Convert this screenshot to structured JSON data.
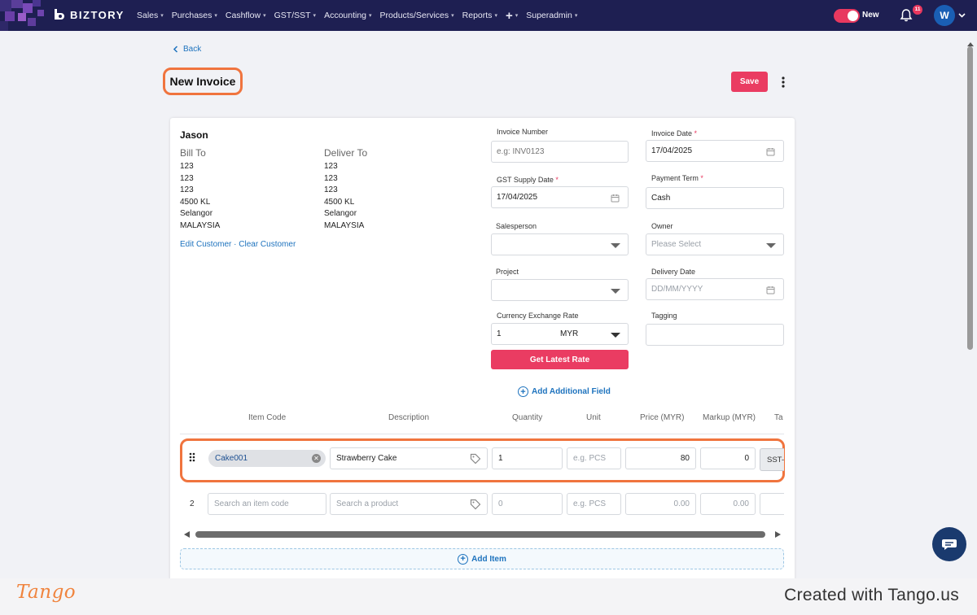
{
  "app": {
    "brand": "BIZTORY",
    "menu": [
      {
        "label": "Sales"
      },
      {
        "label": "Purchases"
      },
      {
        "label": "Cashflow"
      },
      {
        "label": "GST/SST"
      },
      {
        "label": "Accounting"
      },
      {
        "label": "Products/Services"
      },
      {
        "label": "Reports"
      },
      {
        "label": "+"
      },
      {
        "label": "Superadmin"
      }
    ],
    "toggle_label": "New",
    "notification_count": "11",
    "avatar_initial": "W",
    "colors": {
      "nav_bg": "#1e1f52",
      "accent": "#ea3c62",
      "link": "#1e73be",
      "highlight": "#f0743e"
    }
  },
  "page": {
    "back_label": "Back",
    "title": "New Invoice",
    "save_label": "Save"
  },
  "customer": {
    "name": "Jason",
    "bill_to_title": "Bill To",
    "bill_to": [
      "123",
      "123",
      "123",
      "4500 KL",
      "Selangor",
      "MALAYSIA"
    ],
    "deliver_to_title": "Deliver To",
    "deliver_to": [
      "123",
      "123",
      "123",
      "4500 KL",
      "Selangor",
      "MALAYSIA"
    ],
    "edit_link": "Edit Customer",
    "separator": " · ",
    "clear_link": "Clear Customer"
  },
  "fields": {
    "invoice_number": {
      "label": "Invoice Number",
      "placeholder": "e.g: INV0123"
    },
    "invoice_date": {
      "label": "Invoice Date",
      "required": "*",
      "value": "17/04/2025"
    },
    "gst_supply_date": {
      "label": "GST Supply Date",
      "required": "*",
      "value": "17/04/2025"
    },
    "payment_term": {
      "label": "Payment Term",
      "required": "*",
      "value": "Cash"
    },
    "salesperson": {
      "label": "Salesperson",
      "value": ""
    },
    "owner": {
      "label": "Owner",
      "placeholder": "Please Select"
    },
    "project": {
      "label": "Project",
      "value": ""
    },
    "delivery_date": {
      "label": "Delivery Date",
      "placeholder": "DD/MM/YYYY"
    },
    "currency_exchange_rate": {
      "label": "Currency Exchange Rate",
      "rate": "1",
      "currency": "MYR"
    },
    "tagging": {
      "label": "Tagging",
      "value": ""
    },
    "get_rate_label": "Get Latest Rate",
    "add_field_label": "Add Additional Field"
  },
  "items": {
    "columns": [
      "Item Code",
      "Description",
      "Quantity",
      "Unit",
      "Price (MYR)",
      "Markup (MYR)",
      "Ta"
    ],
    "rows": [
      {
        "item_code": "Cake001",
        "description": "Strawberry Cake",
        "quantity": "1",
        "unit_placeholder": "e.g. PCS",
        "price": "80",
        "markup": "0",
        "tax": "SST-"
      },
      {
        "number": "2",
        "item_code_placeholder": "Search an item code",
        "description_placeholder": "Search a product",
        "quantity_placeholder": "0",
        "unit_placeholder": "e.g. PCS",
        "price_placeholder": "0.00",
        "markup_placeholder": "0.00"
      }
    ],
    "add_item_label": "Add Item"
  },
  "footer": {
    "logo": "Tango",
    "credit": "Created with Tango.us"
  }
}
